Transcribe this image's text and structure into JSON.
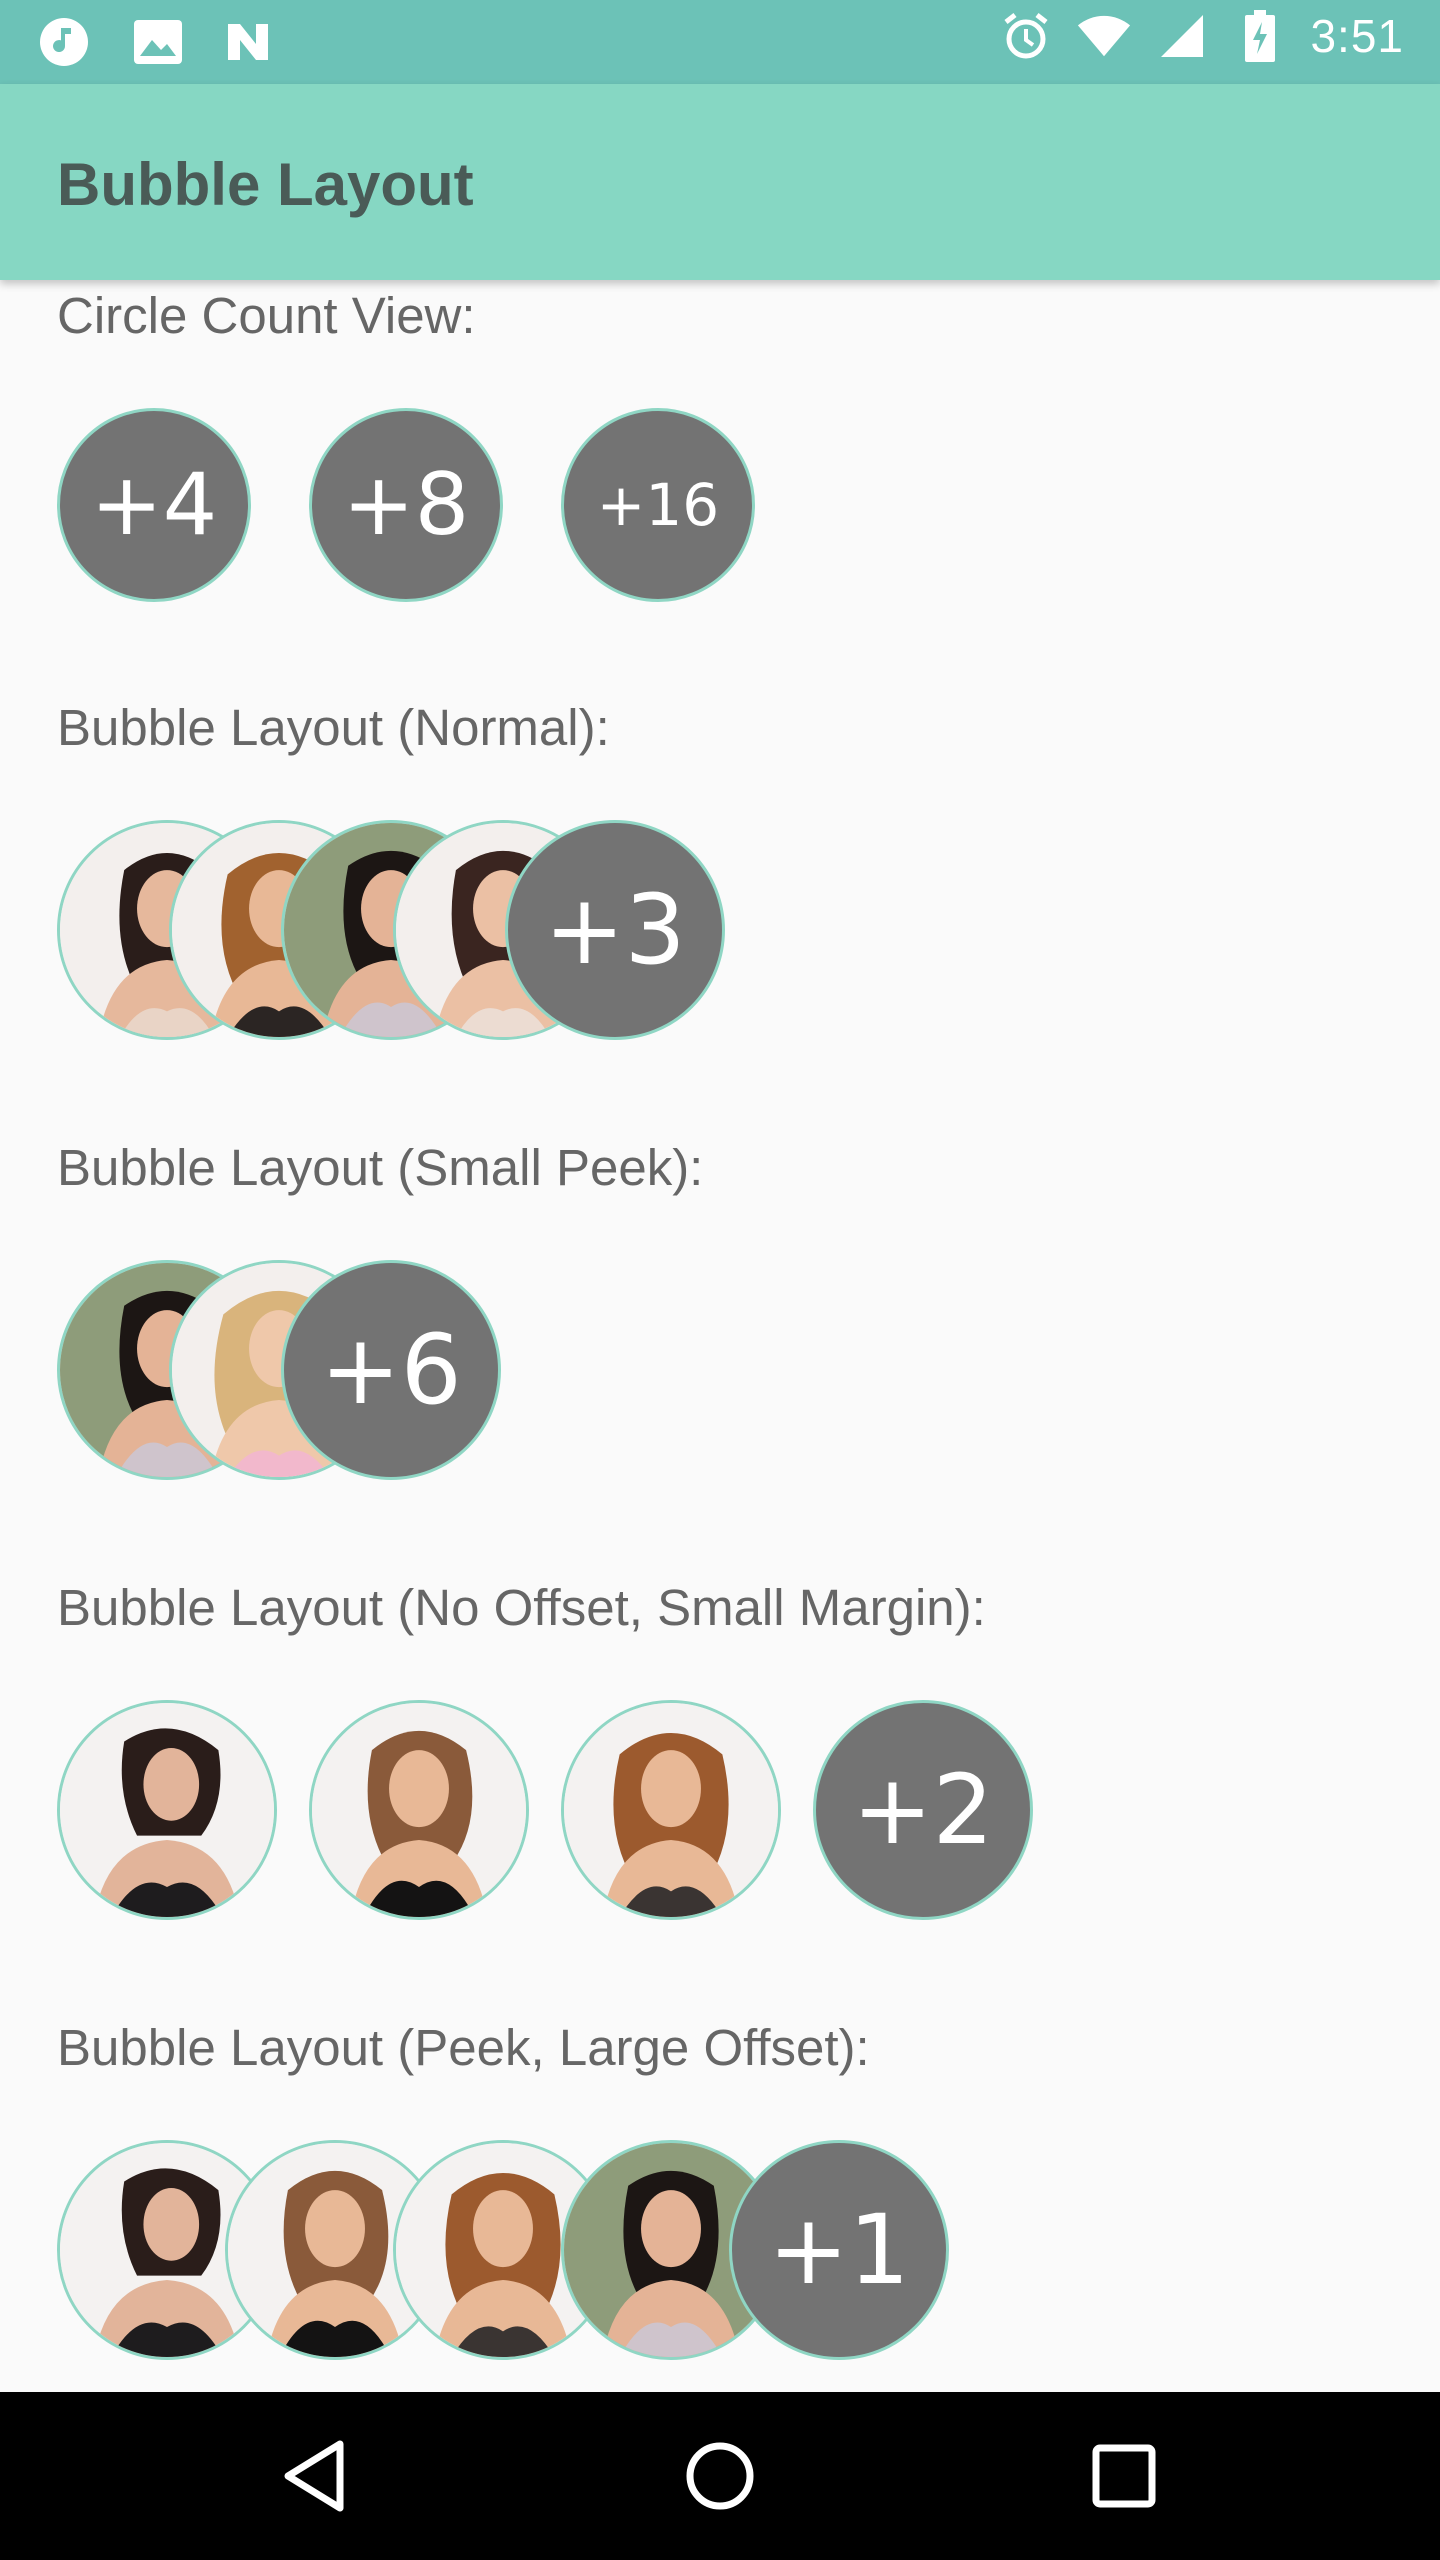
{
  "status_bar": {
    "time": "3:51",
    "left_icons": [
      "music-note-icon",
      "image-icon",
      "n-logo-icon"
    ],
    "right_icons": [
      "alarm-icon",
      "wifi-icon",
      "signal-icon",
      "battery-charging-icon"
    ],
    "background": "#6cc2b7"
  },
  "app_bar": {
    "title": "Bubble Layout",
    "background": "#86d7c3"
  },
  "sections": [
    {
      "label": "Circle Count View:",
      "counts": [
        "+4",
        "+8",
        "+16"
      ]
    },
    {
      "label": "Bubble Layout (Normal):",
      "photos": [
        "brunette-woman-1",
        "auburn-woman-1",
        "brunette-woman-2",
        "brunette-woman-3"
      ],
      "count": "+3"
    },
    {
      "label": "Bubble Layout (Small Peek):",
      "photos": [
        "brunette-woman-2",
        "blonde-woman-1"
      ],
      "count": "+6"
    },
    {
      "label": "Bubble Layout (No Offset, Small Margin):",
      "photos": [
        "brunette-woman-4",
        "brunette-woman-5",
        "auburn-woman-2"
      ],
      "count": "+2"
    },
    {
      "label": "Bubble Layout (Peek, Large Offset):",
      "photos": [
        "brunette-woman-4",
        "brunette-woman-5",
        "auburn-woman-2",
        "brunette-woman-2"
      ],
      "count": "+1"
    }
  ],
  "colors": {
    "count_bubble": "#737373",
    "bubble_border": "#8fd6c4",
    "page_background": "#fafafa",
    "section_text": "#666666"
  },
  "nav_bar": {
    "buttons": [
      "back-icon",
      "home-icon",
      "recents-icon"
    ]
  }
}
